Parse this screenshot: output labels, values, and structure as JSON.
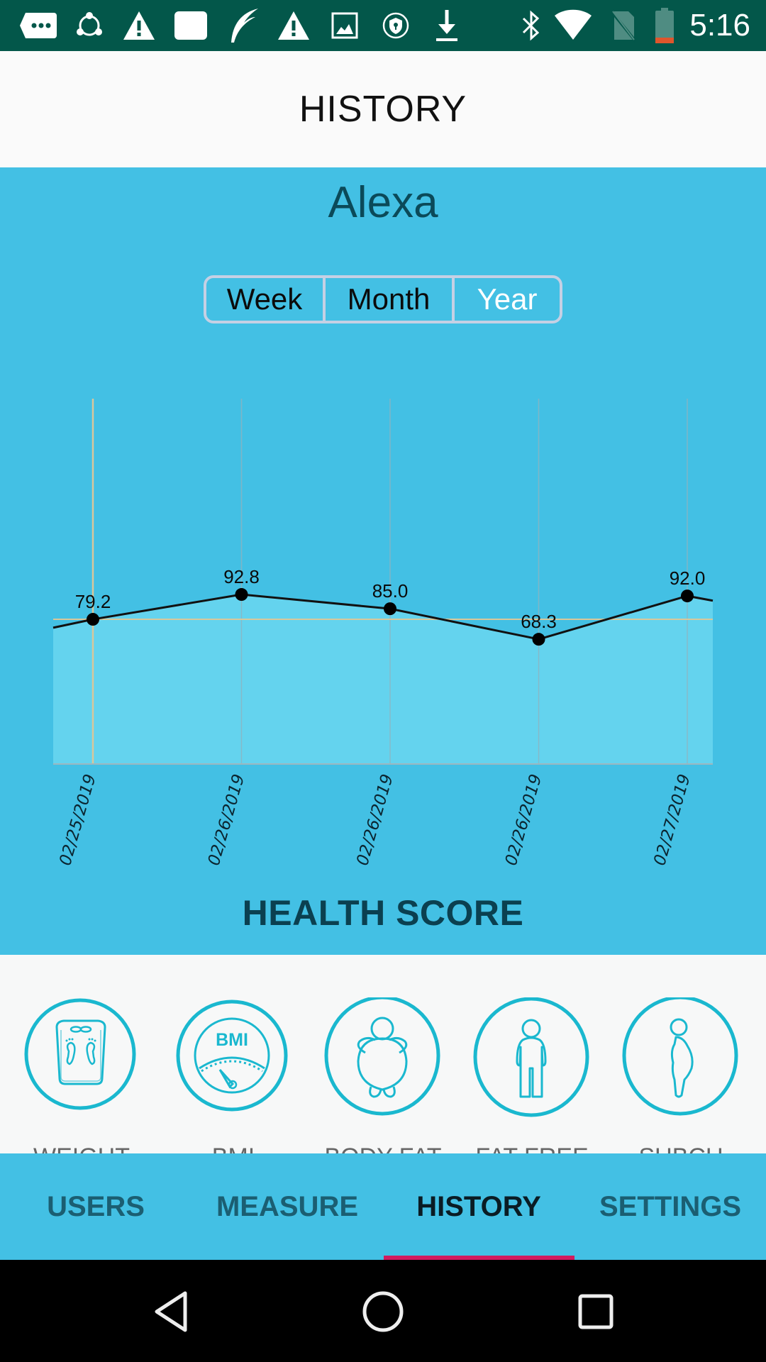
{
  "status_bar": {
    "time": "5:16",
    "left_icons": [
      "message-icon",
      "sync-icon",
      "warning-icon",
      "app-icon",
      "feather-icon",
      "warning-icon",
      "image-icon",
      "vpn-shield-icon",
      "download-icon"
    ],
    "right_icons": [
      "bluetooth-icon",
      "wifi-icon",
      "no-sim-icon",
      "battery-low-icon"
    ],
    "battery_level_fraction": 0.15
  },
  "header": {
    "title": "HISTORY"
  },
  "profile": {
    "user_name": "Alexa"
  },
  "period_selector": {
    "options": [
      "Week",
      "Month",
      "Year"
    ],
    "selected": "Year"
  },
  "chart_data": {
    "type": "area",
    "title": "HEALTH SCORE",
    "categories": [
      "02/25/2019",
      "02/26/2019",
      "02/26/2019",
      "02/26/2019",
      "02/27/2019"
    ],
    "values": [
      79.2,
      92.8,
      85.0,
      68.3,
      92.0
    ],
    "value_labels": [
      "79.2",
      "92.8",
      "85.0",
      "68.3",
      "92.0"
    ],
    "offscreen_left_value": 62,
    "offscreen_right_value": 77,
    "highlighted_index": 0,
    "xlabel": "",
    "ylabel": "",
    "ylim": [
      0,
      200
    ],
    "grid": "vertical",
    "legend": "none",
    "colors": {
      "line": "#111111",
      "fill": "#64d3ee",
      "highlight": "#d9c79a",
      "grid": "#8fb3bf",
      "point": "#000000"
    }
  },
  "section_title": "HEALTH SCORE",
  "metrics": [
    {
      "label": "WEIGHT",
      "icon": "scale-icon"
    },
    {
      "label": "BMI",
      "icon": "bmi-gauge-icon",
      "icon_text": "BMI"
    },
    {
      "label": "BODY FAT",
      "icon": "body-fat-icon"
    },
    {
      "label": "FAT FREE",
      "icon": "fat-free-body-icon"
    },
    {
      "label": "SUBCU",
      "icon": "subcutaneous-fat-icon"
    }
  ],
  "tabs": [
    {
      "label": "USERS",
      "active": false
    },
    {
      "label": "MEASURE",
      "active": false
    },
    {
      "label": "HISTORY",
      "active": true
    },
    {
      "label": "SETTINGS",
      "active": false
    }
  ],
  "nav_bar": [
    "back-icon",
    "home-icon",
    "recents-icon"
  ],
  "theme": {
    "primary": "#43c0e4",
    "status_bar": "#03574a",
    "accent_indicator": "#d21a5e",
    "icon_teal": "#1ab8cf"
  }
}
